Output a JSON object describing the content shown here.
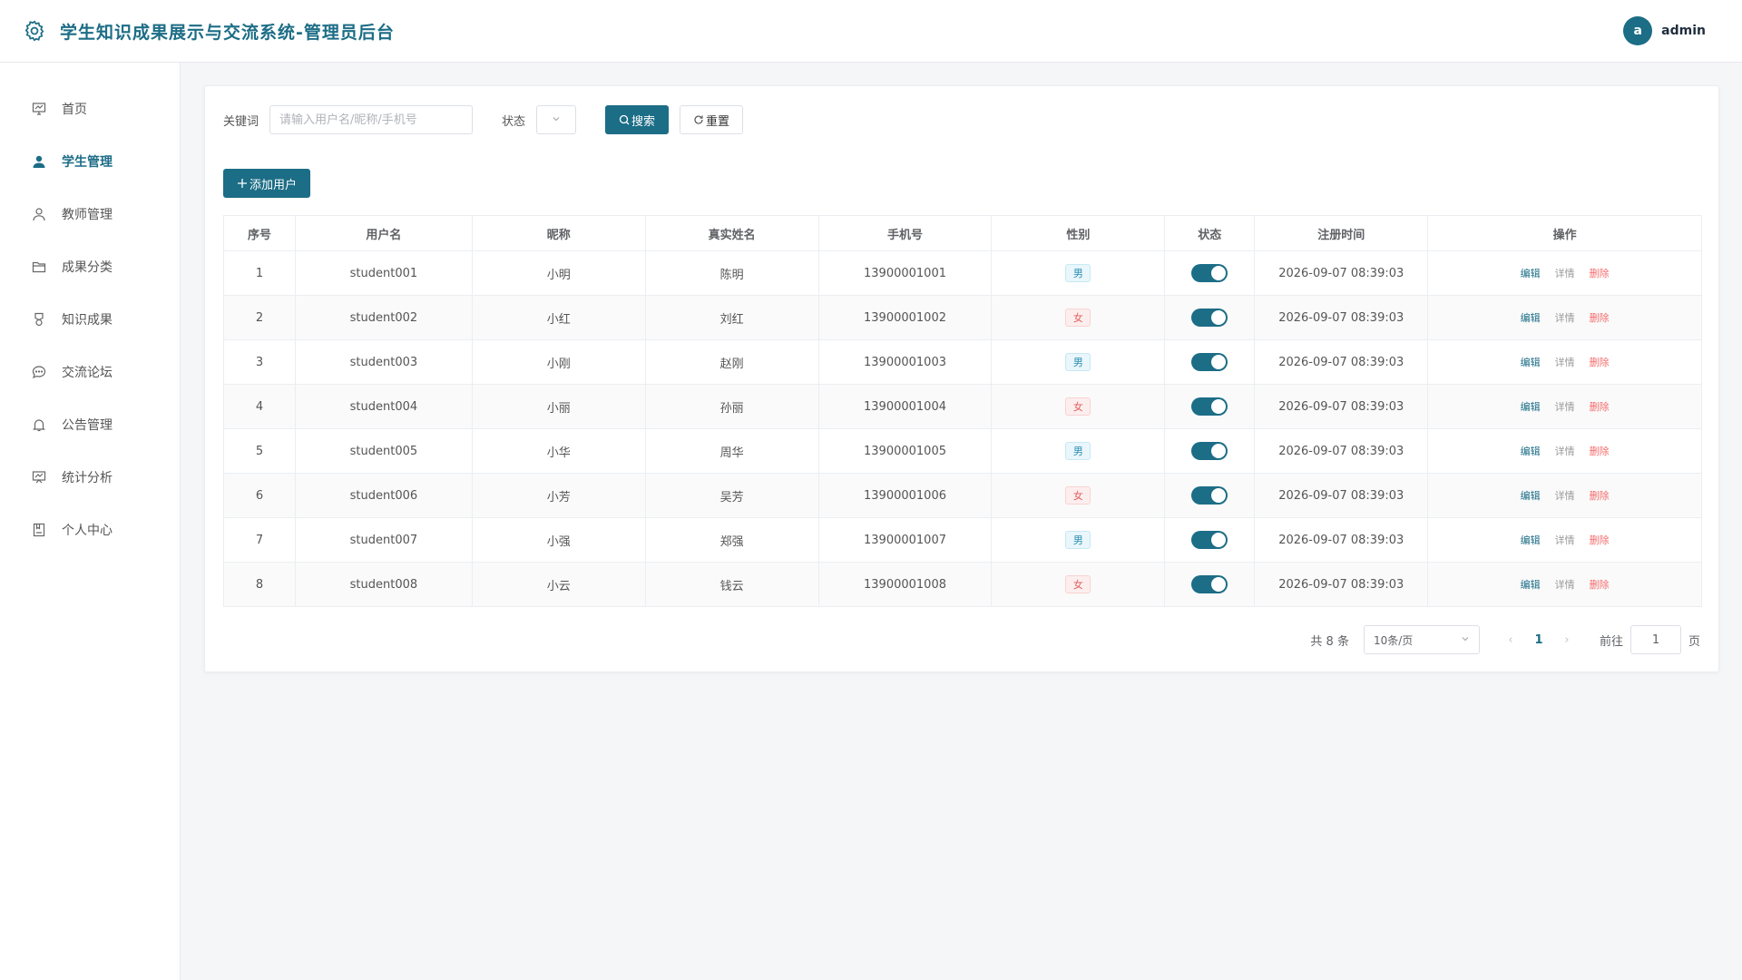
{
  "header": {
    "title": "学生知识成果展示与交流系统-管理员后台",
    "avatar_letter": "a",
    "user_name": "admin"
  },
  "sidebar": {
    "items": [
      {
        "label": "首页",
        "icon": "dashboard-icon"
      },
      {
        "label": "学生管理",
        "icon": "user-filled-icon",
        "active": true
      },
      {
        "label": "教师管理",
        "icon": "user-icon"
      },
      {
        "label": "成果分类",
        "icon": "folder-icon"
      },
      {
        "label": "知识成果",
        "icon": "medal-icon"
      },
      {
        "label": "交流论坛",
        "icon": "chat-icon"
      },
      {
        "label": "公告管理",
        "icon": "bell-icon"
      },
      {
        "label": "统计分析",
        "icon": "chart-icon"
      },
      {
        "label": "个人中心",
        "icon": "profile-icon"
      }
    ]
  },
  "search": {
    "keyword_label": "关键词",
    "keyword_placeholder": "请输入用户名/昵称/手机号",
    "status_label": "状态",
    "search_button": "搜索",
    "reset_button": "重置"
  },
  "toolbar": {
    "add_button": "添加用户"
  },
  "table": {
    "columns": [
      "序号",
      "用户名",
      "昵称",
      "真实姓名",
      "手机号",
      "性别",
      "状态",
      "注册时间",
      "操作"
    ],
    "rows": [
      {
        "index": "1",
        "username": "student001",
        "nickname": "小明",
        "realname": "陈明",
        "phone": "13900001001",
        "gender": "男",
        "status": true,
        "created": "2026-09-07 08:39:03"
      },
      {
        "index": "2",
        "username": "student002",
        "nickname": "小红",
        "realname": "刘红",
        "phone": "13900001002",
        "gender": "女",
        "status": true,
        "created": "2026-09-07 08:39:03"
      },
      {
        "index": "3",
        "username": "student003",
        "nickname": "小刚",
        "realname": "赵刚",
        "phone": "13900001003",
        "gender": "男",
        "status": true,
        "created": "2026-09-07 08:39:03"
      },
      {
        "index": "4",
        "username": "student004",
        "nickname": "小丽",
        "realname": "孙丽",
        "phone": "13900001004",
        "gender": "女",
        "status": true,
        "created": "2026-09-07 08:39:03"
      },
      {
        "index": "5",
        "username": "student005",
        "nickname": "小华",
        "realname": "周华",
        "phone": "13900001005",
        "gender": "男",
        "status": true,
        "created": "2026-09-07 08:39:03"
      },
      {
        "index": "6",
        "username": "student006",
        "nickname": "小芳",
        "realname": "吴芳",
        "phone": "13900001006",
        "gender": "女",
        "status": true,
        "created": "2026-09-07 08:39:03"
      },
      {
        "index": "7",
        "username": "student007",
        "nickname": "小强",
        "realname": "郑强",
        "phone": "13900001007",
        "gender": "男",
        "status": true,
        "created": "2026-09-07 08:39:03"
      },
      {
        "index": "8",
        "username": "student008",
        "nickname": "小云",
        "realname": "钱云",
        "phone": "13900001008",
        "gender": "女",
        "status": true,
        "created": "2026-09-07 08:39:03"
      }
    ],
    "actions": {
      "edit": "编辑",
      "detail": "详情",
      "delete": "删除"
    }
  },
  "pagination": {
    "total_text": "共 8 条",
    "page_size": "10条/页",
    "current_page": "1",
    "goto_label": "前往",
    "goto_value": "1",
    "page_suffix": "页"
  },
  "colors": {
    "accent": "#1c6d86",
    "danger": "#f56c6c"
  }
}
